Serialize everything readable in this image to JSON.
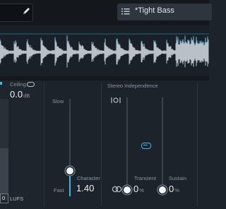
{
  "header": {
    "preset_name": "*Tight Bass",
    "icons": {
      "edit": "pencil-icon",
      "presets": "list-icon"
    }
  },
  "left_panel": {
    "ceiling_label": "Ceiling",
    "ceiling_value": "0.0",
    "ceiling_unit": "dB",
    "loudness_box": "0",
    "loudness_unit": "LUFS"
  },
  "character_panel": {
    "slow_label": "Slow",
    "fast_label": "Fast",
    "character_label": "Character",
    "character_value": "1.40"
  },
  "stereo_panel": {
    "title": "Stereo Independence",
    "transient_label": "Transient",
    "transient_value": "0",
    "transient_unit": "%",
    "sustain_label": "Sustain",
    "sustain_value": "0",
    "sustain_unit": "%"
  },
  "colors": {
    "accent": "#3db8e8",
    "background": "#1d232a",
    "waveform": "#b9c0c7"
  }
}
